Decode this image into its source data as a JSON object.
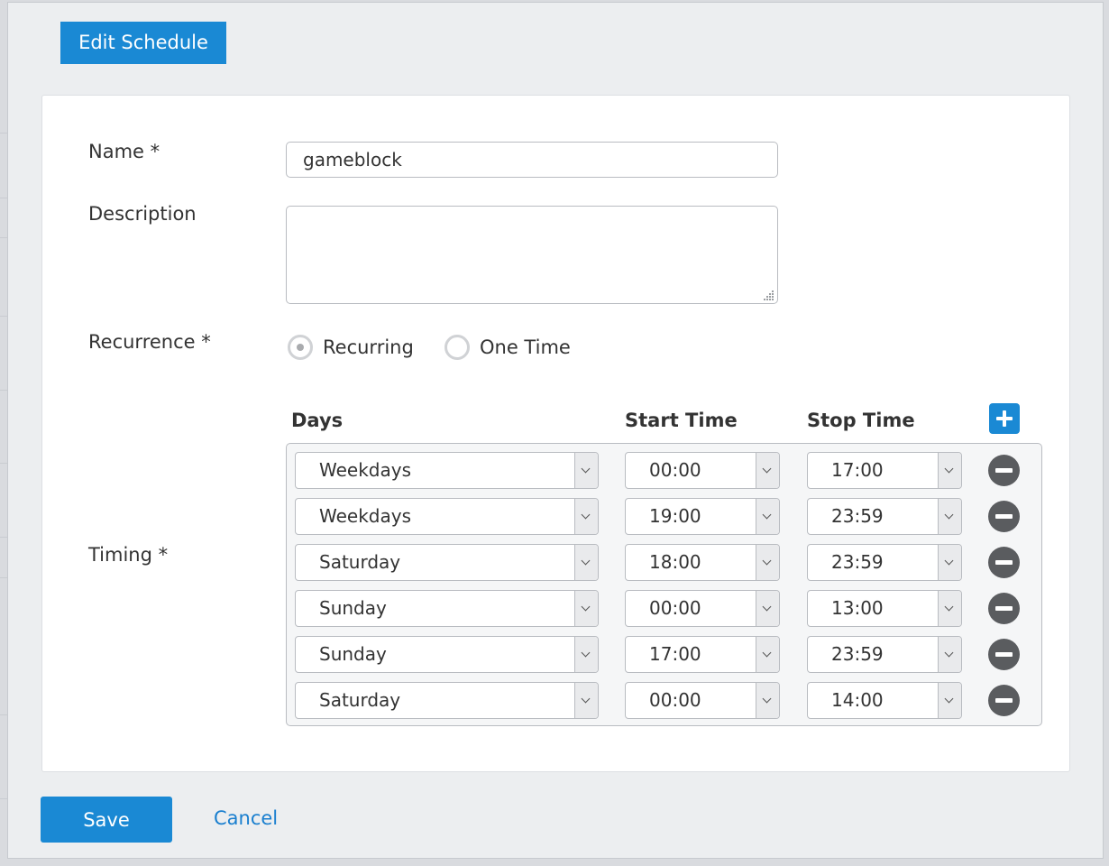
{
  "dialog": {
    "title": "Edit Schedule"
  },
  "form": {
    "name": {
      "label": "Name *",
      "value": "gameblock"
    },
    "description": {
      "label": "Description",
      "value": ""
    },
    "recurrence": {
      "label": "Recurrence *",
      "options": [
        {
          "label": "Recurring",
          "selected": true
        },
        {
          "label": "One Time",
          "selected": false
        }
      ]
    },
    "timing": {
      "label": "Timing *",
      "headers": {
        "days": "Days",
        "start": "Start Time",
        "stop": "Stop Time"
      },
      "rows": [
        {
          "days": "Weekdays",
          "start": "00:00",
          "stop": "17:00"
        },
        {
          "days": "Weekdays",
          "start": "19:00",
          "stop": "23:59"
        },
        {
          "days": "Saturday",
          "start": "18:00",
          "stop": "23:59"
        },
        {
          "days": "Sunday",
          "start": "00:00",
          "stop": "13:00"
        },
        {
          "days": "Sunday",
          "start": "17:00",
          "stop": "23:59"
        },
        {
          "days": "Saturday",
          "start": "00:00",
          "stop": "14:00"
        }
      ]
    }
  },
  "actions": {
    "save_label": "Save",
    "cancel_label": "Cancel"
  },
  "icons": {
    "add": "plus-icon",
    "remove": "minus-circle-icon",
    "dropdown": "chevron-down-icon"
  },
  "colors": {
    "accent": "#1a89d4",
    "link": "#1a7fcf",
    "remove_button": "#5a5c5f",
    "overlay_bg": "#eceef0"
  }
}
